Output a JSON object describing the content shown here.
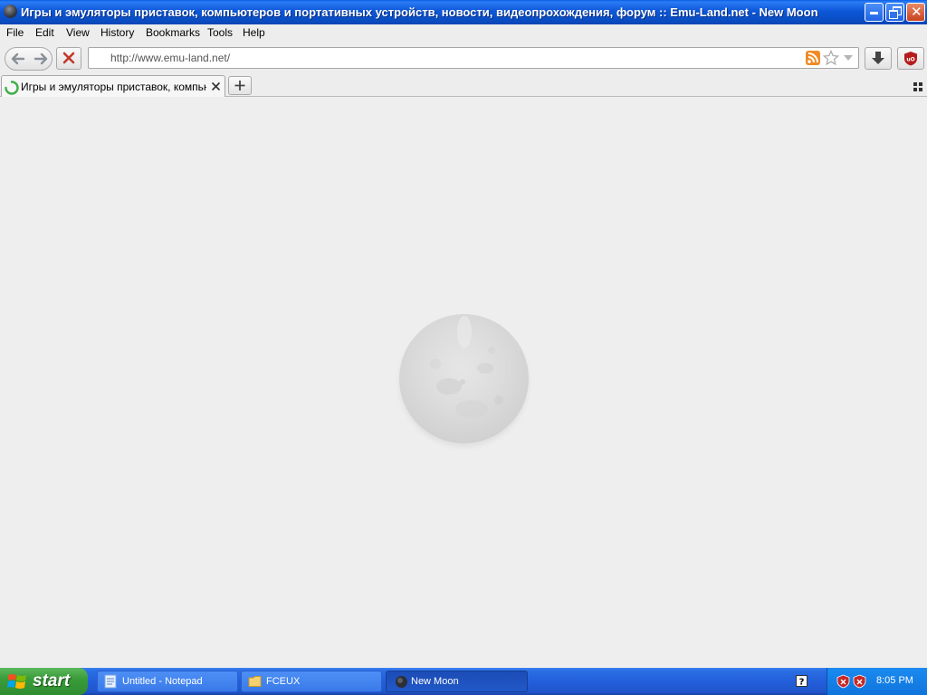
{
  "window": {
    "title": "Игры и эмуляторы приставок, компьютеров и портативных устройств, новости, видеопрохождения, форум :: Emu-Land.net - New Moon"
  },
  "menu": {
    "file": "File",
    "edit": "Edit",
    "view": "View",
    "history": "History",
    "bookmarks": "Bookmarks",
    "tools": "Tools",
    "help": "Help"
  },
  "navbar": {
    "url": "http://www.emu-land.net/"
  },
  "tabs": [
    {
      "label": "Игры и эмуляторы приставок, компьюте...",
      "loading": true
    }
  ],
  "taskbar": {
    "start_label": "start",
    "items": [
      {
        "label": "Untitled - Notepad",
        "icon": "notepad-icon"
      },
      {
        "label": "FCEUX",
        "icon": "folder-icon"
      },
      {
        "label": "New Moon",
        "icon": "new-moon-icon",
        "active": true
      }
    ],
    "clock": "8:05 PM"
  },
  "colors": {
    "titlebar": "#0a4ec4",
    "taskbar": "#245edb",
    "start": "#3a9c3a",
    "rss": "#f08a24",
    "stop": "#c0392b",
    "ublock": "#b71c1c",
    "loading_spinner": "#3fae49"
  }
}
